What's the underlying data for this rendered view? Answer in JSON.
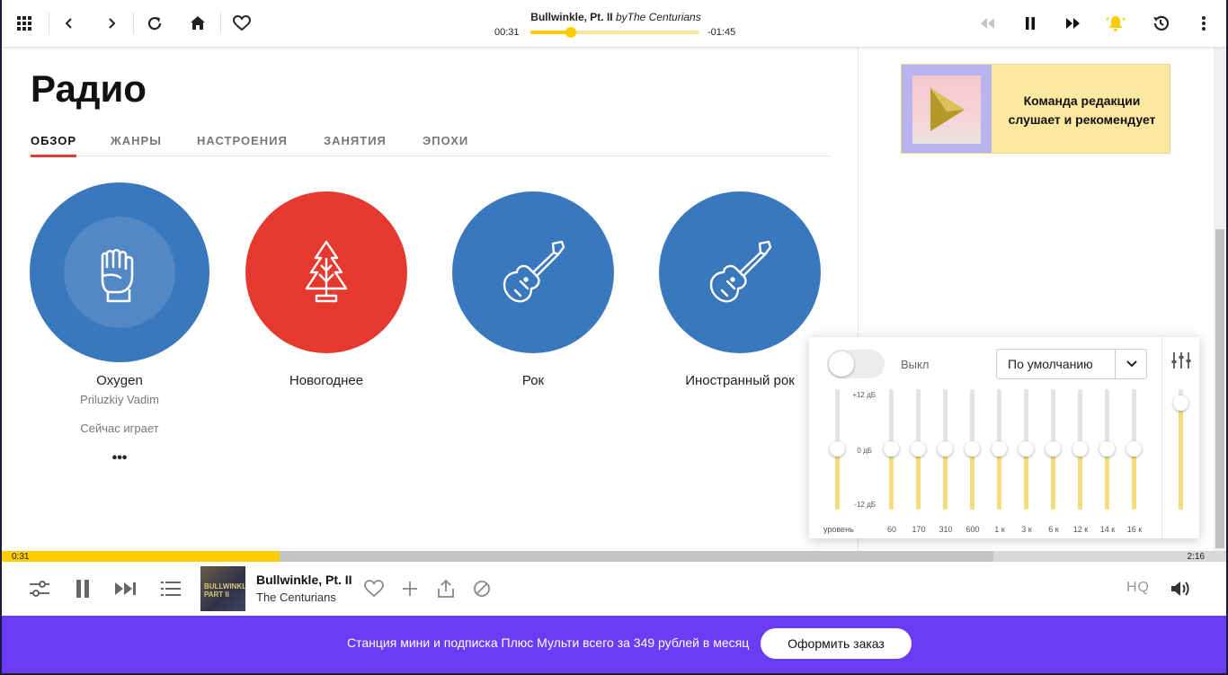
{
  "topbar": {
    "track_title": "Bullwinkle, Pt. II",
    "by": "by",
    "track_artist": "The Centurians",
    "time_elapsed": "00:31",
    "time_remaining": "-01:45",
    "progress": 0.24,
    "accent": "#ffcc00"
  },
  "main": {
    "title": "Радио",
    "tabs": [
      {
        "label": "ОБЗОР",
        "active": true
      },
      {
        "label": "ЖАНРЫ"
      },
      {
        "label": "НАСТРОЕНИЯ"
      },
      {
        "label": "ЗАНЯТИЯ"
      },
      {
        "label": "ЭПОХИ"
      }
    ],
    "stations": [
      {
        "name": "Oxygen",
        "author": "Priluzkiy Vadim",
        "status": "Сейчас играет",
        "more": "•••",
        "icon": "fist-icon",
        "color": "#3b7bbf"
      },
      {
        "name": "Новогоднее",
        "icon": "fir-tree-icon",
        "color": "#e5392f"
      },
      {
        "name": "Рок",
        "icon": "guitar-icon",
        "color": "#3b7bbf"
      },
      {
        "name": "Иностранный рок",
        "icon": "guitar-icon",
        "color": "#3b7bbf"
      }
    ]
  },
  "promo": {
    "text": "Команда редакции слушает и рекомендует"
  },
  "equalizer": {
    "state_label": "Выкл",
    "preset": "По умолчанию",
    "db_labels": [
      "+12 дБ",
      "0 дБ",
      "-12 дБ"
    ],
    "level_label": "уровень",
    "bands": [
      "60",
      "170",
      "310",
      "600",
      "1 к",
      "3 к",
      "6 к",
      "12 к",
      "14 к",
      "16 к"
    ],
    "band_values_db": [
      0,
      0,
      0,
      0,
      0,
      0,
      0,
      0,
      0,
      0
    ],
    "level_value_db": 0,
    "volume": 0.88
  },
  "player": {
    "elapsed": "0:31",
    "duration": "2:16",
    "progress": 0.227,
    "buffered": 0.81,
    "title": "Bullwinkle, Pt. II",
    "artist": "The Centurians",
    "cover_text": "BULLWINKLE PART II",
    "hq_label": "HQ"
  },
  "banner": {
    "text": "Станция мини и подписка Плюс Мульти всего за 349 рублей в месяц",
    "button": "Оформить заказ",
    "color": "#6a3cf6"
  }
}
